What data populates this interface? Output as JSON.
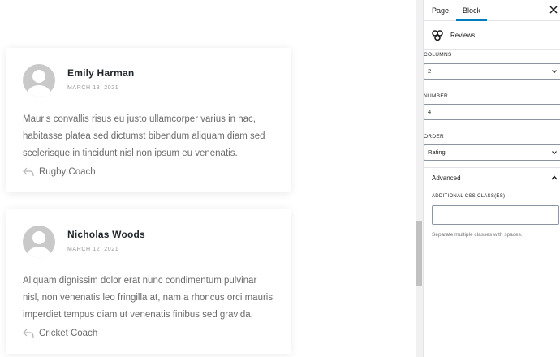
{
  "reviews": [
    {
      "name": "Emily Harman",
      "date": "MARCH 13, 2021",
      "text": "Mauris convallis risus eu justo ullamcorper varius in hac, habitasse platea sed dictumst bibendum aliquam diam sed scelerisque in tincidunt nisl non ipsum eu venenatis.",
      "role": "Rugby Coach"
    },
    {
      "name": "Nicholas Woods",
      "date": "MARCH 12, 2021",
      "text": "Aliquam dignissim dolor erat nunc condimentum pulvinar nisl, non venenatis leo fringilla at, nam a rhoncus orci mauris imperdiet tempus diam ut venenatis finibus sed gravida.",
      "role": "Cricket Coach"
    }
  ],
  "sidebar": {
    "tabs": {
      "page": "Page",
      "block": "Block",
      "active": "block"
    },
    "block_name": "Reviews",
    "block_icon": "reviews-block-icon",
    "fields": {
      "columns_label": "COLUMNS",
      "columns_value": "2",
      "number_label": "NUMBER",
      "number_value": "4",
      "order_label": "ORDER",
      "order_value": "Rating"
    },
    "advanced": {
      "title": "Advanced",
      "css_label": "ADDITIONAL CSS CLASS(ES)",
      "css_value": "",
      "help": "Separate multiple classes with spaces."
    }
  },
  "colors": {
    "accent": "#007cba",
    "card_bg": "#ffffff",
    "text_muted": "#6b6b6b",
    "avatar": "#c9c9c9"
  },
  "icons": {
    "close": "close-icon",
    "role": "reply-arrow-icon",
    "collapse": "chevron-up-icon",
    "select": "chevron-down-icon",
    "avatar": "user-avatar-icon"
  }
}
